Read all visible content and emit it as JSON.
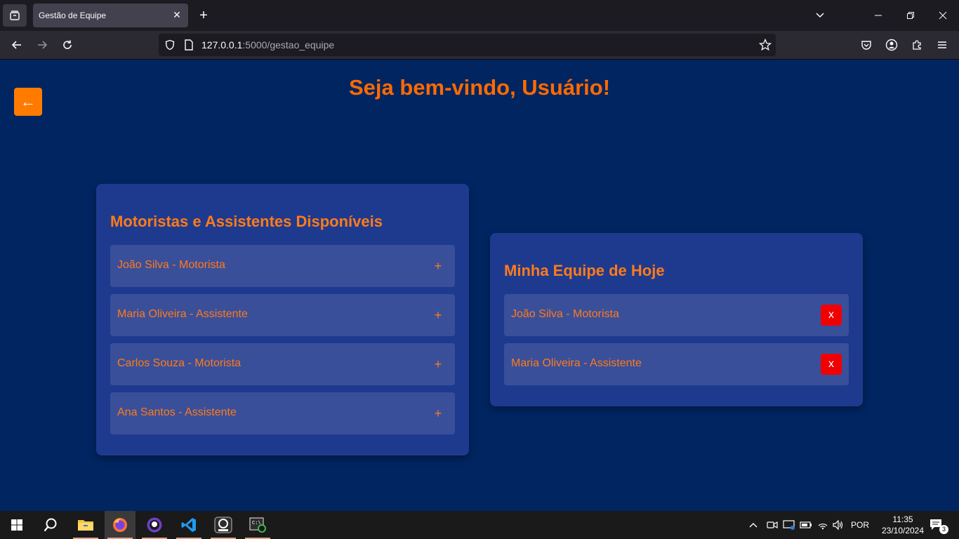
{
  "browser": {
    "tab_title": "Gestão de Equipe",
    "url_host": "127.0.0.1",
    "url_rest": ":5000/gestao_equipe"
  },
  "page": {
    "back_label": "←",
    "welcome": "Seja bem-vindo, Usuário!",
    "available": {
      "title": "Motoristas e Assistentes Disponíveis",
      "add_label": "+",
      "items": [
        "João Silva - Motorista",
        "Maria Oliveira - Assistente",
        "Carlos Souza - Motorista",
        "Ana Santos - Assistente"
      ]
    },
    "team": {
      "title": "Minha Equipe de Hoje",
      "remove_label": "x",
      "items": [
        "João Silva - Motorista",
        "Maria Oliveira - Assistente"
      ]
    }
  },
  "taskbar": {
    "language": "POR",
    "time": "11:35",
    "date": "23/10/2024",
    "notification_count": "3"
  },
  "colors": {
    "page_bg": "#002561",
    "card_bg": "#1e3a8f",
    "item_bg": "#3a4f9a",
    "accent": "#ff7b00",
    "remove": "#f00000"
  }
}
